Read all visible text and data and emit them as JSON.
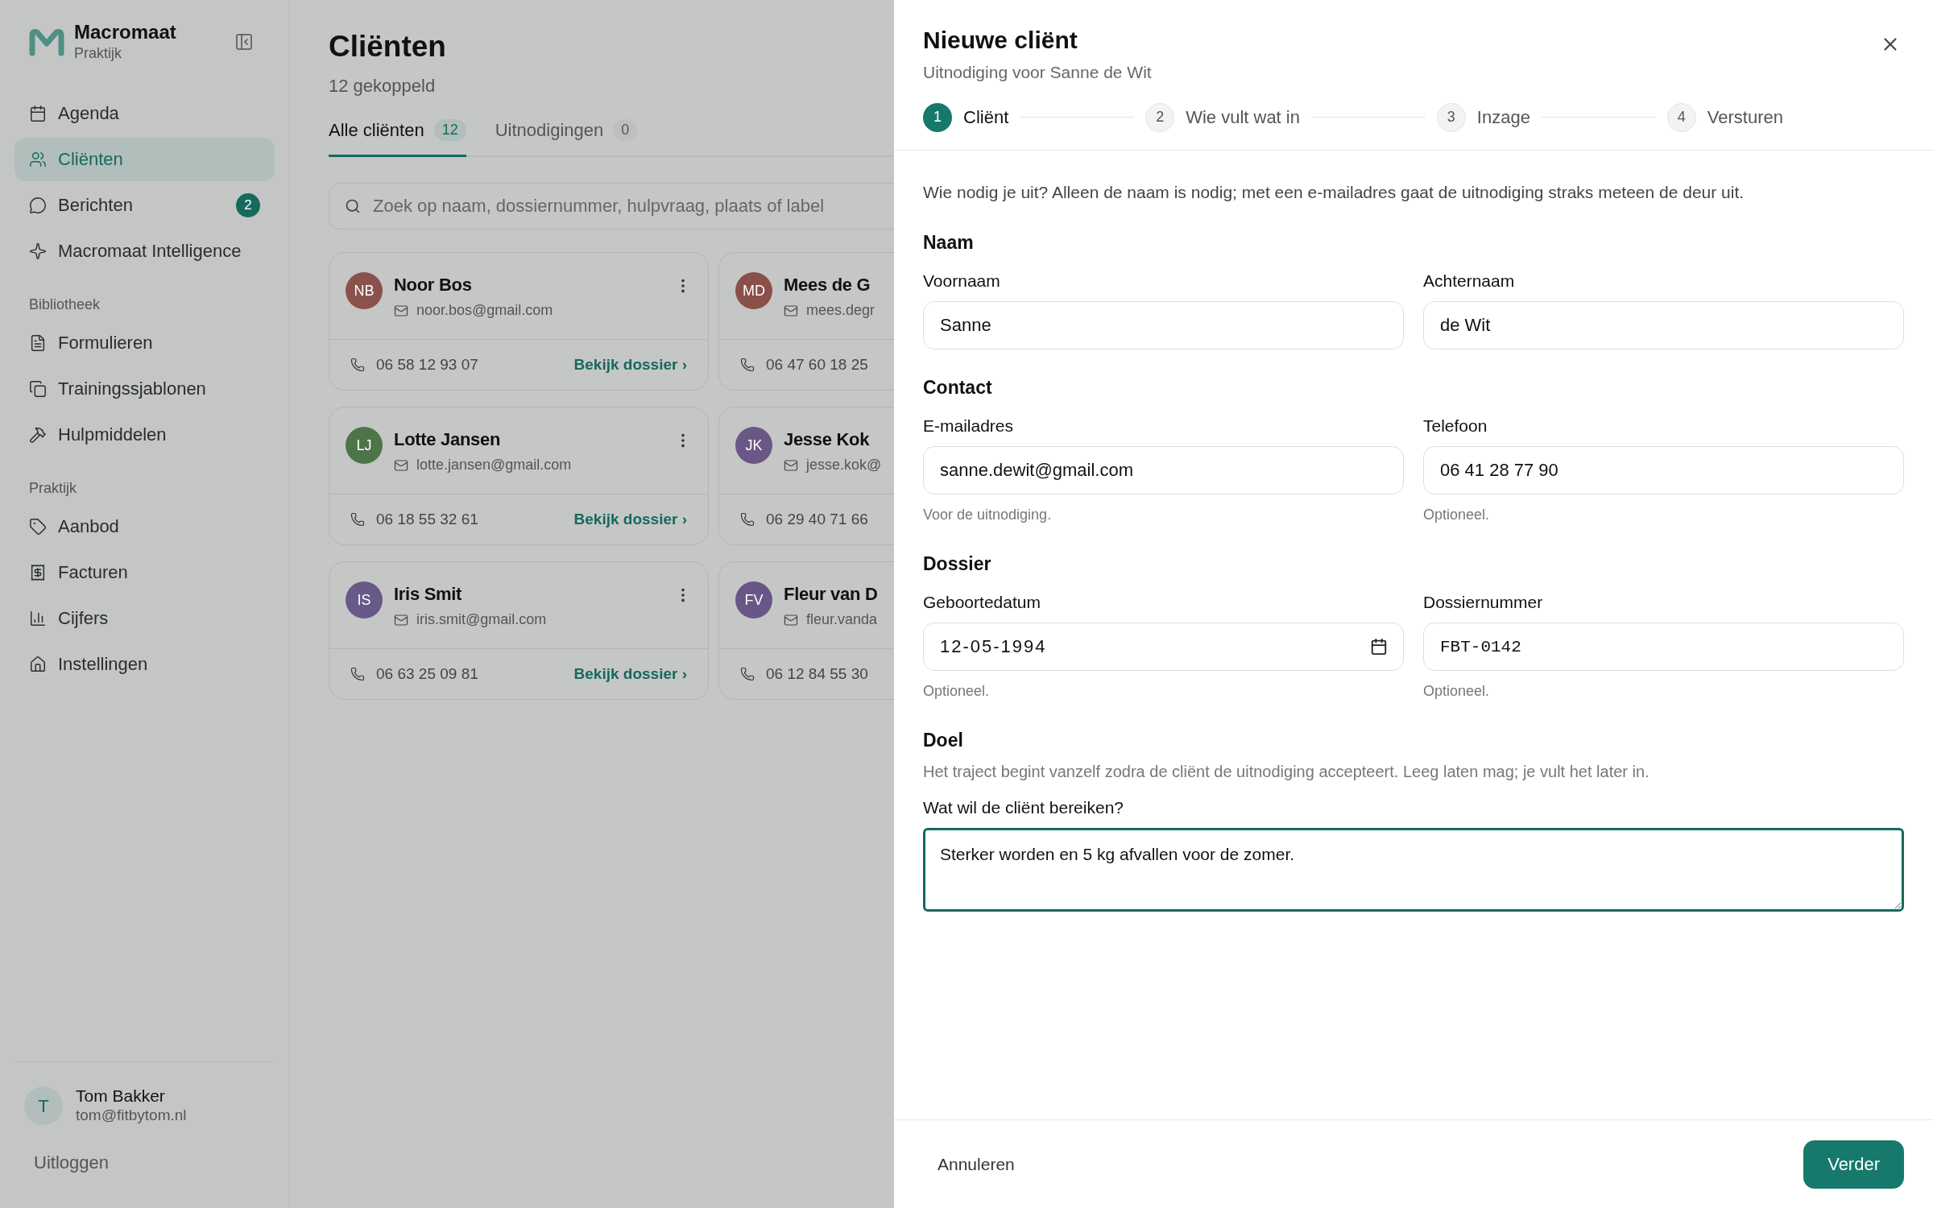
{
  "sidebar": {
    "brand": {
      "name": "Macromaat",
      "subtitle": "Praktijk"
    },
    "groups": [
      {
        "items": [
          {
            "label": "Agenda",
            "selected": false
          },
          {
            "label": "Cliënten",
            "selected": true
          },
          {
            "label": "Berichten",
            "selected": false,
            "badge": "2"
          },
          {
            "label": "Macromaat Intelligence",
            "selected": false
          }
        ]
      },
      {
        "heading": "Bibliotheek",
        "items": [
          {
            "label": "Formulieren",
            "selected": false
          },
          {
            "label": "Trainingssjablonen",
            "selected": false
          },
          {
            "label": "Hulpmiddelen",
            "selected": false
          }
        ]
      },
      {
        "heading": "Praktijk",
        "items": [
          {
            "label": "Aanbod",
            "selected": false
          },
          {
            "label": "Facturen",
            "selected": false
          },
          {
            "label": "Cijfers",
            "selected": false
          },
          {
            "label": "Instellingen",
            "selected": false
          }
        ]
      }
    ],
    "user": {
      "initial": "T",
      "name": "Tom Bakker",
      "email": "tom@fitbytom.nl"
    },
    "logout": "Uitloggen"
  },
  "page": {
    "title": "Cliënten",
    "subtitle": "12 gekoppeld",
    "tabs": [
      {
        "label": "Alle cliënten",
        "count": "12",
        "selected": true
      },
      {
        "label": "Uitnodigingen",
        "count": "0",
        "selected": false
      }
    ],
    "search": {
      "placeholder": "Zoek op naam, dossiernummer, hulpvraag, plaats of label"
    },
    "clients": [
      {
        "initials": "NB",
        "color": "#8a514d",
        "name": "Noor Bos",
        "email": "noor.bos@gmail.com",
        "phone": "06 58 12 93 07",
        "link": "Bekijk dossier ›"
      },
      {
        "initials": "MD",
        "color": "#8b4f4a",
        "name": "Mees de G",
        "email": "mees.degr",
        "phone": "06 47 60 18 25"
      },
      {
        "initials": "LJ",
        "color": "#4e7449",
        "name": "Lotte Jansen",
        "email": "lotte.jansen@gmail.com",
        "phone": "06 18 55 32 61",
        "link": "Bekijk dossier ›"
      },
      {
        "initials": "JK",
        "color": "#6b5785",
        "name": "Jesse Kok",
        "email": "jesse.kok@",
        "phone": "06 29 40 71 66"
      },
      {
        "initials": "IS",
        "color": "#675a89",
        "name": "Iris Smit",
        "email": "iris.smit@gmail.com",
        "phone": "06 63 25 09 81",
        "link": "Bekijk dossier ›"
      },
      {
        "initials": "FV",
        "color": "#6a5686",
        "name": "Fleur van D",
        "email": "fleur.vanda",
        "phone": "06 12 84 55 30"
      }
    ]
  },
  "drawer": {
    "title": "Nieuwe cliënt",
    "subtitle": "Uitnodiging voor Sanne de Wit",
    "steps": [
      {
        "number": "1",
        "label": "Cliënt",
        "selected": true
      },
      {
        "number": "2",
        "label": "Wie vult wat in",
        "selected": false
      },
      {
        "number": "3",
        "label": "Inzage",
        "selected": false
      },
      {
        "number": "4",
        "label": "Versturen",
        "selected": false
      }
    ],
    "intro": "Wie nodig je uit? Alleen de naam is nodig; met een e-mailadres gaat de uitnodiging straks meteen de deur uit.",
    "sections": [
      {
        "title": "Naam",
        "fields": [
          {
            "kind": "text",
            "label": "Voornaam",
            "value": "Sanne",
            "focused": false
          },
          {
            "kind": "text",
            "label": "Achternaam",
            "value": "de Wit",
            "focused": false
          }
        ]
      },
      {
        "title": "Contact",
        "fields": [
          {
            "kind": "text",
            "label": "E-mailadres",
            "value": "sanne.dewit@gmail.com",
            "help": "Voor de uitnodiging.",
            "focused": false
          },
          {
            "kind": "text",
            "label": "Telefoon",
            "value": "06 41 28 77 90",
            "help": "Optioneel.",
            "focused": false
          }
        ]
      },
      {
        "title": "Dossier",
        "fields": [
          {
            "kind": "date",
            "label": "Geboortedatum",
            "value": "12-05-1994",
            "help": "Optioneel.",
            "focused": false
          },
          {
            "kind": "code",
            "label": "Dossiernummer",
            "value": "FBT-0142",
            "help": "Optioneel.",
            "focused": false
          }
        ]
      },
      {
        "title": "Doel",
        "description": "Het traject begint vanzelf zodra de cliënt de uitnodiging accepteert. Leeg laten mag; je vult het later in.",
        "fields": [
          {
            "kind": "textarea",
            "label": "Wat wil de cliënt bereiken?",
            "value": "Sterker worden en 5 kg afvallen voor de zomer.",
            "focused": true
          }
        ]
      }
    ],
    "cancel": "Annuleren",
    "next": "Verder"
  }
}
